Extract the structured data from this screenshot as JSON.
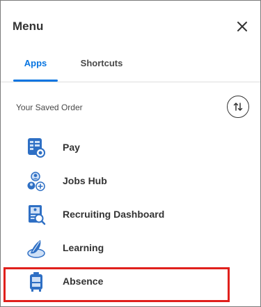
{
  "menu": {
    "title": "Menu",
    "close_icon": "close-icon"
  },
  "tabs": [
    {
      "label": "Apps",
      "active": true
    },
    {
      "label": "Shortcuts",
      "active": false
    }
  ],
  "saved_order": {
    "title": "Your Saved Order",
    "sort_icon": "sort-arrows-icon"
  },
  "apps": [
    {
      "label": "Pay",
      "icon": "pay-icon"
    },
    {
      "label": "Jobs Hub",
      "icon": "jobs-hub-icon"
    },
    {
      "label": "Recruiting Dashboard",
      "icon": "recruiting-dashboard-icon"
    },
    {
      "label": "Learning",
      "icon": "learning-icon"
    },
    {
      "label": "Absence",
      "icon": "absence-icon",
      "highlighted": true
    }
  ],
  "colors": {
    "accent": "#0875e1",
    "highlight_border": "#e0201c",
    "icon_blue": "#2e6fc4",
    "icon_light": "#cfe0f6"
  }
}
